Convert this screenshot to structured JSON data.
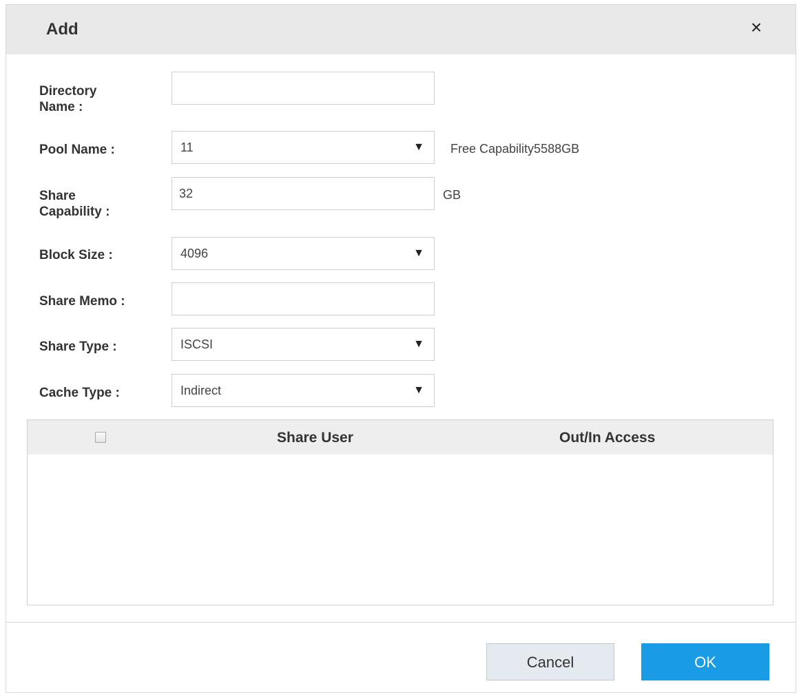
{
  "dialog": {
    "title": "Add",
    "close_glyph": "×"
  },
  "form": {
    "directory_name": {
      "label_line1": "Directory",
      "label_line2": "Name :",
      "value": ""
    },
    "pool_name": {
      "label": "Pool Name :",
      "value": "11",
      "free_capability": "Free Capability5588GB"
    },
    "share_capability": {
      "label_line1": "Share",
      "label_line2": "Capability :",
      "value": "32",
      "unit": "GB"
    },
    "block_size": {
      "label": "Block Size :",
      "value": "4096"
    },
    "share_memo": {
      "label": "Share Memo :",
      "value": ""
    },
    "share_type": {
      "label": "Share Type :",
      "value": "ISCSI"
    },
    "cache_type": {
      "label": "Cache Type :",
      "value": "Indirect"
    }
  },
  "table": {
    "columns": [
      "Share User",
      "Out/In Access"
    ],
    "rows": []
  },
  "buttons": {
    "cancel": "Cancel",
    "ok": "OK"
  },
  "icons": {
    "close": "close-icon",
    "dropdown": "chevron-down-icon",
    "checkbox": "checkbox-icon"
  },
  "colors": {
    "titlebar": "#e9e9e9",
    "ok_button": "#1a9be6",
    "cancel_button": "#e4eaf0"
  }
}
